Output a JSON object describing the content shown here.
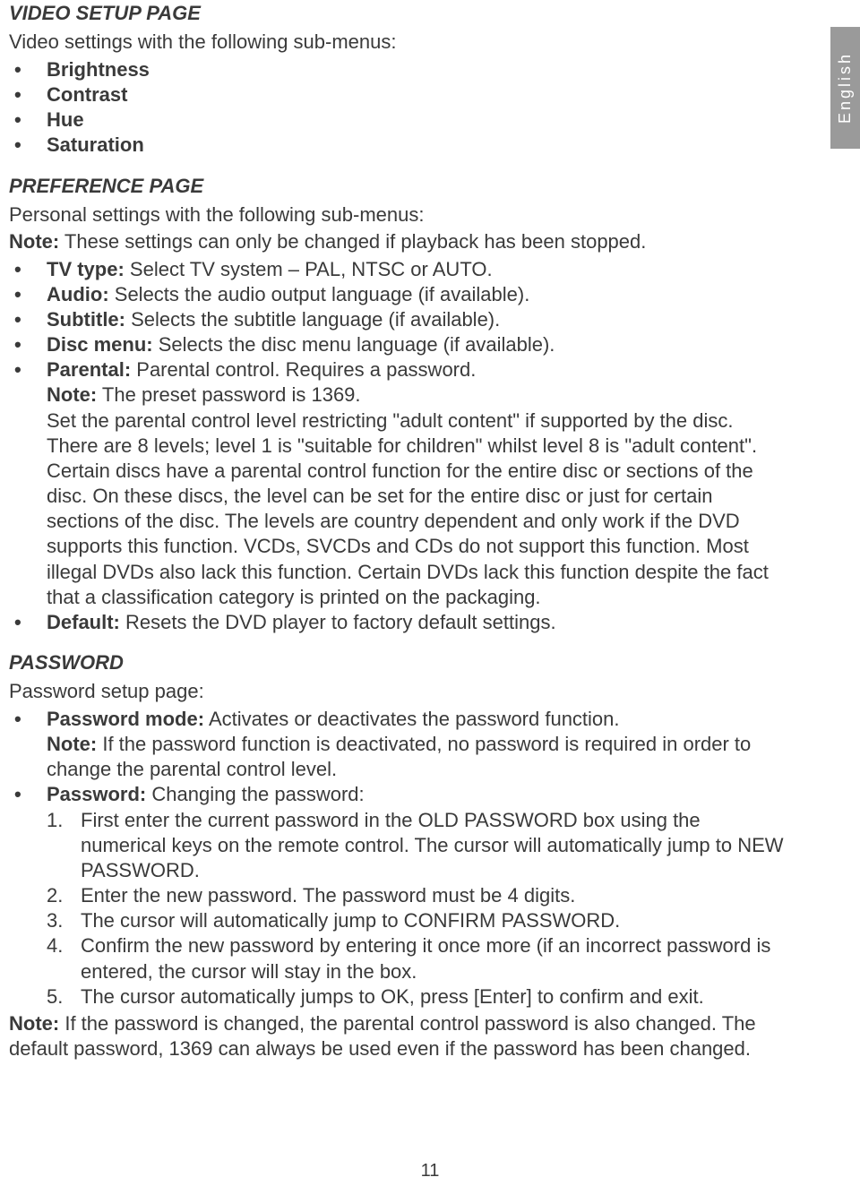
{
  "langTab": "English",
  "videoSetup": {
    "heading": "VIDEO SETUP PAGE",
    "intro": "Video settings with the following sub-menus:",
    "items": [
      "Brightness",
      "Contrast",
      "Hue",
      "Saturation"
    ]
  },
  "preference": {
    "heading": "PREFERENCE PAGE",
    "intro": "Personal settings with the following sub-menus:",
    "noteLabel": "Note:",
    "noteText": " These settings can only be changed if playback has been stopped.",
    "items": [
      {
        "label": "TV type:",
        "text": " Select TV system – PAL, NTSC or AUTO."
      },
      {
        "label": "Audio:",
        "text": " Selects the audio output language (if available)."
      },
      {
        "label": "Subtitle:",
        "text": " Selects the subtitle language (if available)."
      },
      {
        "label": "Disc menu:",
        "text": " Selects the disc menu language (if available)."
      }
    ],
    "parental": {
      "label": "Parental:",
      "text": " Parental control. Requires a password.",
      "noteLabel": "Note:",
      "noteText": " The preset password is 1369.",
      "body": "Set the parental control level restricting \"adult content\" if supported by the disc. There are 8 levels; level 1 is \"suitable for children\" whilst level 8 is \"adult content\". Certain discs have a parental control function for the entire disc or sections of the disc. On these discs, the level can be set for the entire disc or just for certain sections of the disc. The levels are country dependent and only work if the DVD supports this function. VCDs, SVCDs and CDs do not support this function. Most illegal DVDs also lack this function. Certain DVDs lack this function despite the fact that a classification category is printed on the packaging."
    },
    "default": {
      "label": "Default:",
      "text": " Resets the DVD player to factory default settings."
    }
  },
  "password": {
    "heading": "PASSWORD",
    "intro": "Password setup page:",
    "mode": {
      "label": "Password mode:",
      "text": " Activates or deactivates the password function.",
      "noteLabel": "Note:",
      "noteText": " If the password function is deactivated, no password is required in order to change the parental control level."
    },
    "change": {
      "label": "Password:",
      "text": " Changing the password:",
      "steps": [
        "First enter the current password in the OLD PASSWORD box using the numerical keys on the remote control. The cursor will automatically jump to NEW PASSWORD.",
        "Enter the new password. The password must be 4 digits.",
        "The cursor will automatically jump to CONFIRM PASSWORD.",
        "Confirm the new password by entering it once more (if an incorrect password is entered, the cursor will stay in the box.",
        "The cursor automatically jumps to OK, press [Enter] to confirm and exit."
      ]
    },
    "footerNoteLabel": "Note:",
    "footerNoteText": " If the password is changed, the parental control password is also changed. The default password, 1369 can always be used even if the password has been changed."
  },
  "pageNumber": "11"
}
